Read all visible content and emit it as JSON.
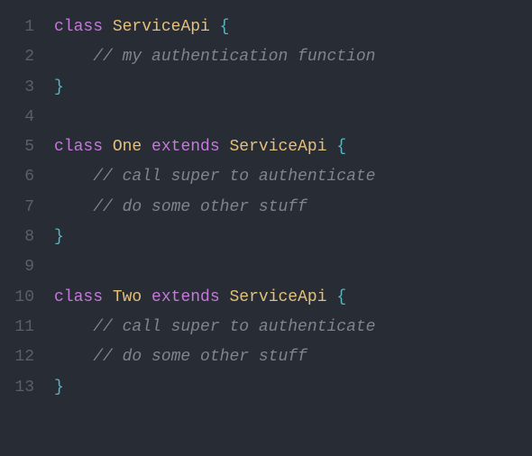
{
  "code": {
    "lines": [
      {
        "num": "1",
        "tokens": [
          [
            "kw",
            "class"
          ],
          [
            "pn",
            " "
          ],
          [
            "cls",
            "ServiceApi"
          ],
          [
            "pn",
            " "
          ],
          [
            "br",
            "{"
          ]
        ]
      },
      {
        "num": "2",
        "tokens": [
          [
            "pn",
            "    "
          ],
          [
            "cmt",
            "// my authentication function"
          ]
        ]
      },
      {
        "num": "3",
        "tokens": [
          [
            "br",
            "}"
          ]
        ]
      },
      {
        "num": "4",
        "tokens": []
      },
      {
        "num": "5",
        "tokens": [
          [
            "kw",
            "class"
          ],
          [
            "pn",
            " "
          ],
          [
            "cls",
            "One"
          ],
          [
            "pn",
            " "
          ],
          [
            "kw",
            "extends"
          ],
          [
            "pn",
            " "
          ],
          [
            "cls",
            "ServiceApi"
          ],
          [
            "pn",
            " "
          ],
          [
            "br",
            "{"
          ]
        ]
      },
      {
        "num": "6",
        "tokens": [
          [
            "pn",
            "    "
          ],
          [
            "cmt",
            "// call super to authenticate"
          ]
        ]
      },
      {
        "num": "7",
        "tokens": [
          [
            "pn",
            "    "
          ],
          [
            "cmt",
            "// do some other stuff"
          ]
        ]
      },
      {
        "num": "8",
        "tokens": [
          [
            "br",
            "}"
          ]
        ]
      },
      {
        "num": "9",
        "tokens": []
      },
      {
        "num": "10",
        "tokens": [
          [
            "kw",
            "class"
          ],
          [
            "pn",
            " "
          ],
          [
            "cls",
            "Two"
          ],
          [
            "pn",
            " "
          ],
          [
            "kw",
            "extends"
          ],
          [
            "pn",
            " "
          ],
          [
            "cls",
            "ServiceApi"
          ],
          [
            "pn",
            " "
          ],
          [
            "br",
            "{"
          ]
        ]
      },
      {
        "num": "11",
        "tokens": [
          [
            "pn",
            "    "
          ],
          [
            "cmt",
            "// call super to authenticate"
          ]
        ]
      },
      {
        "num": "12",
        "tokens": [
          [
            "pn",
            "    "
          ],
          [
            "cmt",
            "// do some other stuff"
          ]
        ]
      },
      {
        "num": "13",
        "tokens": [
          [
            "br",
            "}"
          ]
        ]
      }
    ]
  }
}
